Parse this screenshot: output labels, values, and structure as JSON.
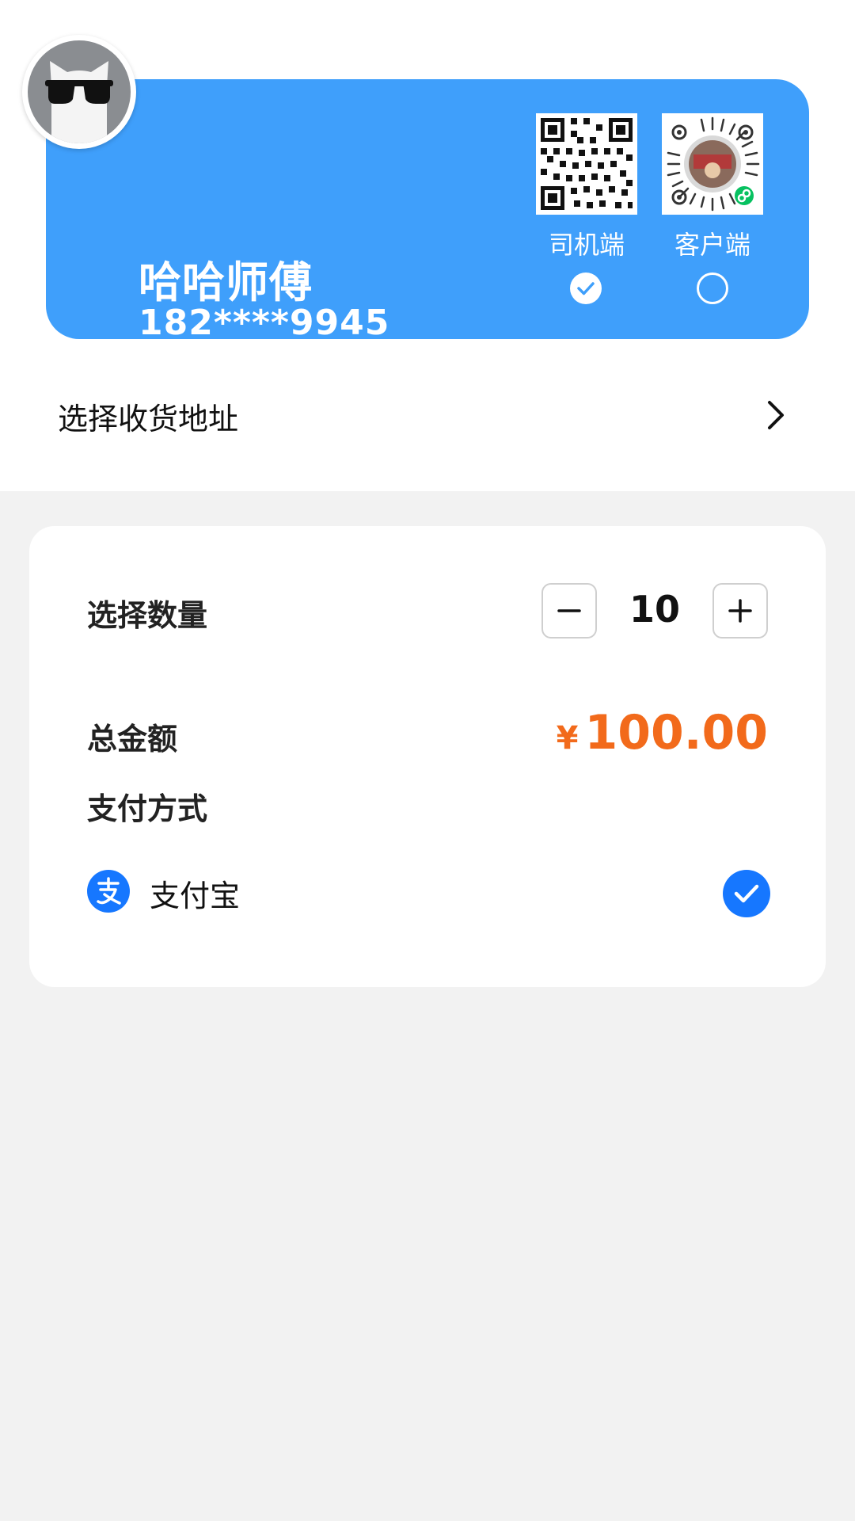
{
  "profile": {
    "name": "哈哈师傅",
    "phone": "182****9945",
    "card_color": "#3f9ffb",
    "avatar_icon": "cat-sunglasses-avatar",
    "qr_options": [
      {
        "label": "司机端",
        "selected": true,
        "icon": "qr-code-icon"
      },
      {
        "label": "客户端",
        "selected": false,
        "icon": "mini-program-code-icon"
      }
    ]
  },
  "address": {
    "label": "选择收货地址",
    "icon": "chevron-right-icon"
  },
  "order": {
    "quantity_label": "选择数量",
    "quantity": "10",
    "minus_icon": "minus-icon",
    "plus_icon": "plus-icon",
    "total_label": "总金额",
    "currency": "¥",
    "total_value": "100.00",
    "total_color": "#f26a1b",
    "payment_label": "支付方式",
    "payment_method": {
      "name": "支付宝",
      "icon": "alipay-icon",
      "selected": true,
      "color": "#1677ff"
    }
  }
}
